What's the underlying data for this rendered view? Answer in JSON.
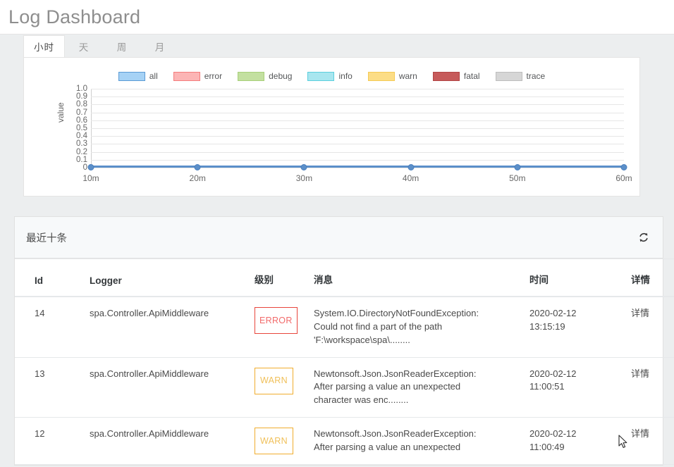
{
  "header": {
    "title": "Log Dashboard"
  },
  "tabs": [
    {
      "label": "小时",
      "active": true
    },
    {
      "label": "天",
      "active": false
    },
    {
      "label": "周",
      "active": false
    },
    {
      "label": "月",
      "active": false
    }
  ],
  "chart_data": {
    "type": "line",
    "title": "",
    "xlabel": "",
    "ylabel": "value",
    "x": [
      "10m",
      "20m",
      "30m",
      "40m",
      "50m",
      "60m"
    ],
    "ylim": [
      0,
      1.0
    ],
    "yticks": [
      "1.0",
      "0.9",
      "0.8",
      "0.7",
      "0.6",
      "0.5",
      "0.4",
      "0.3",
      "0.2",
      "0.1",
      "0"
    ],
    "grid": true,
    "legend_position": "top-center",
    "series": [
      {
        "name": "all",
        "color": "#a6d2f5",
        "border": "#5b9bd5",
        "values": [
          0,
          0,
          0,
          0,
          0,
          0
        ]
      },
      {
        "name": "error",
        "color": "#fcb5b5",
        "border": "#f47c7c",
        "values": [
          0,
          0,
          0,
          0,
          0,
          0
        ]
      },
      {
        "name": "debug",
        "color": "#c3e0a0",
        "border": "#a8cf7a",
        "values": [
          0,
          0,
          0,
          0,
          0,
          0
        ]
      },
      {
        "name": "info",
        "color": "#a8e6ef",
        "border": "#5bcfdd",
        "values": [
          0,
          0,
          0,
          0,
          0,
          0
        ]
      },
      {
        "name": "warn",
        "color": "#fcdd86",
        "border": "#f5ca55",
        "values": [
          0,
          0,
          0,
          0,
          0,
          0
        ]
      },
      {
        "name": "fatal",
        "color": "#c65a5a",
        "border": "#b24545",
        "values": [
          0,
          0,
          0,
          0,
          0,
          0
        ]
      },
      {
        "name": "trace",
        "color": "#d6d6d6",
        "border": "#bdbdbd",
        "values": [
          0,
          0,
          0,
          0,
          0,
          0
        ]
      }
    ],
    "line_color": "#5b8fc9"
  },
  "table_card": {
    "title": "最近十条",
    "refresh_icon": "refresh-icon",
    "columns": [
      "Id",
      "Logger",
      "级别",
      "消息",
      "时间",
      "详情"
    ],
    "rows": [
      {
        "id": "14",
        "logger": "spa.Controller.ApiMiddleware",
        "level": "ERROR",
        "level_kind": "error",
        "message_lines": [
          "System.IO.DirectoryNotFoundException:",
          "Could not find a part of the path",
          "'F:\\workspace\\spa\\........"
        ],
        "time_lines": [
          "2020-02-12",
          "13:15:19"
        ],
        "detail": "详情"
      },
      {
        "id": "13",
        "logger": "spa.Controller.ApiMiddleware",
        "level": "WARN",
        "level_kind": "warn",
        "message_lines": [
          "Newtonsoft.Json.JsonReaderException:",
          "After parsing a value an unexpected",
          "character was enc........"
        ],
        "time_lines": [
          "2020-02-12",
          "11:00:51"
        ],
        "detail": "详情"
      },
      {
        "id": "12",
        "logger": "spa.Controller.ApiMiddleware",
        "level": "WARN",
        "level_kind": "warn",
        "message_lines": [
          "Newtonsoft.Json.JsonReaderException:",
          "After parsing a value an unexpected"
        ],
        "time_lines": [
          "2020-02-12",
          "11:00:49"
        ],
        "detail": "详情"
      }
    ]
  },
  "colors": {
    "page_bg": "#eceeef",
    "card_bg": "#ffffff",
    "accent_line": "#5b8fc9",
    "error": "#e8453c",
    "warn": "#f0ad2e"
  }
}
